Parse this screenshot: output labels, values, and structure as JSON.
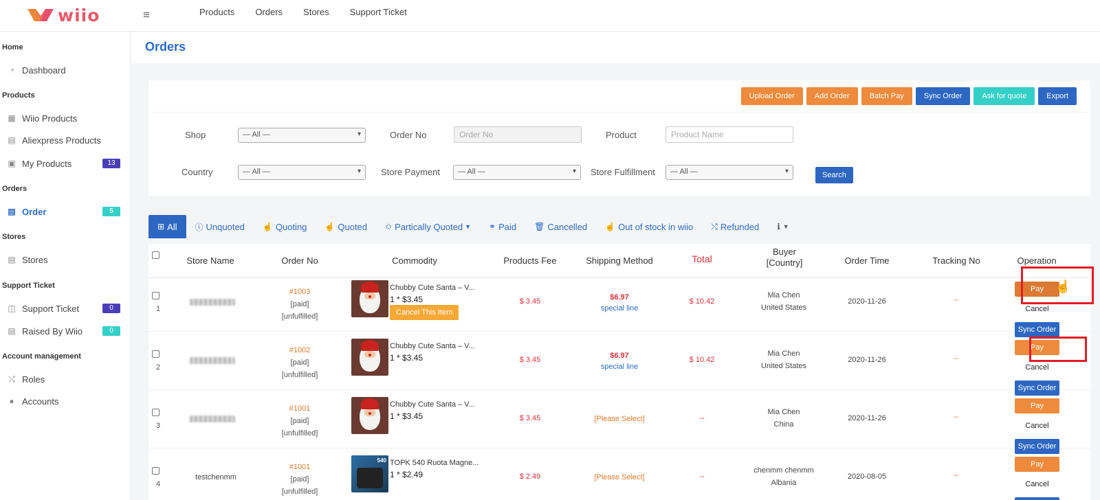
{
  "brand": {
    "name": "wiio"
  },
  "topnav": [
    "Products",
    "Orders",
    "Stores",
    "Support Ticket"
  ],
  "sidebar": {
    "sections": {
      "home": "Home",
      "products": "Products",
      "orders": "Orders",
      "stores": "Stores",
      "support": "Support Ticket",
      "account": "Account management"
    },
    "items": {
      "dashboard": "Dashboard",
      "wiio_products": "Wiio Products",
      "aliexpress_products": "Aliexpress Products",
      "my_products": "My Products",
      "my_products_badge": "13",
      "order": "Order",
      "order_badge": "5",
      "stores": "Stores",
      "support_ticket": "Support Ticket",
      "support_badge": "0",
      "raised_by_wiio": "Raised By Wiio",
      "raised_badge": "0",
      "roles": "Roles",
      "accounts": "Accounts"
    }
  },
  "page": {
    "title": "Orders"
  },
  "actions": {
    "upload": "Upload Order",
    "add": "Add Order",
    "batch_pay": "Batch Pay",
    "sync": "Sync Order",
    "ask_quote": "Ask for quote",
    "export": "Export"
  },
  "filters": {
    "shop_label": "Shop",
    "shop_value": "— All —",
    "orderno_label": "Order No",
    "orderno_placeholder": "Order No",
    "product_label": "Product",
    "product_placeholder": "Product Name",
    "country_label": "Country",
    "country_value": "— All —",
    "payment_label": "Store Payment",
    "payment_value": "— All —",
    "fulfill_label": "Store Fulfillment",
    "fulfill_value": "— All —",
    "search": "Search"
  },
  "tabs": {
    "all": "All",
    "unquoted": "Unquoted",
    "quoting": "Quoting",
    "quoted": "Quoted",
    "partially": "Partically Quoted",
    "paid": "Paid",
    "cancelled": "Cancelled",
    "out_of_stock": "Out of stock in wiio",
    "refunded": "Refunded"
  },
  "table": {
    "headers": {
      "store": "Store Name",
      "orderno": "Order No",
      "commodity": "Commodity",
      "fee": "Products Fee",
      "shipping": "Shipping Method",
      "total": "Total",
      "buyer1": "Buyer",
      "buyer2": "[Country]",
      "time": "Order Time",
      "tracking": "Tracking No",
      "operation": "Operation"
    },
    "rows": [
      {
        "num": "1",
        "store": "",
        "order_id": "#1003",
        "status1": "[paid]",
        "status2": "[unfulfilled]",
        "product": "Chubby Cute Santa – V...",
        "qty": "1 * $3.45",
        "cancel_item": "Cancel This Item",
        "fee": "$ 3.45",
        "ship_price": "$6.97",
        "ship_line": "special line",
        "total": "$ 10.42",
        "buyer": "Mia Chen",
        "country": "United States",
        "time": "2020-11-26",
        "tracking": "--",
        "pay": "Pay",
        "cancel": "Cancel",
        "sync": "Sync Order"
      },
      {
        "num": "2",
        "store": "",
        "order_id": "#1002",
        "status1": "[paid]",
        "status2": "[unfulfilled]",
        "product": "Chubby Cute Santa – V...",
        "qty": "1 * $3.45",
        "fee": "$ 3.45",
        "ship_price": "$6.97",
        "ship_line": "special line",
        "total": "$ 10.42",
        "buyer": "Mia Chen",
        "country": "United States",
        "time": "2020-11-26",
        "tracking": "--",
        "pay": "Pay",
        "cancel": "Cancel",
        "sync": "Sync Order"
      },
      {
        "num": "3",
        "store": "",
        "order_id": "#1001",
        "status1": "[paid]",
        "status2": "[unfulfilled]",
        "product": "Chubby Cute Santa – V...",
        "qty": "1 * $3.45",
        "fee": "$ 3.45",
        "ship_select": "[Please Select]",
        "total": "--",
        "buyer": "Mia Chen",
        "country": "China",
        "time": "2020-11-26",
        "tracking": "--",
        "pay": "Pay",
        "cancel": "Cancel",
        "sync": "Sync Order"
      },
      {
        "num": "4",
        "store": "testchenmm",
        "order_id": "#1001",
        "status1": "[paid]",
        "status2": "[unfulfilled]",
        "product": "TOPK 540 Ruota Magne...",
        "thumb_label": "540",
        "qty": "1 * $2.49",
        "fee": "$ 2.49",
        "ship_select": "[Please Select]",
        "total": "--",
        "buyer": "chenmm chenmm",
        "country": "Albania",
        "time": "2020-08-05",
        "tracking": "--",
        "pay": "Pay",
        "cancel": "Cancel"
      }
    ]
  },
  "colors": {
    "primary": "#2d67c2",
    "orange": "#ee8a3c",
    "teal": "#34d0c8",
    "red": "#d9323a",
    "highlight": "#e31b23"
  }
}
